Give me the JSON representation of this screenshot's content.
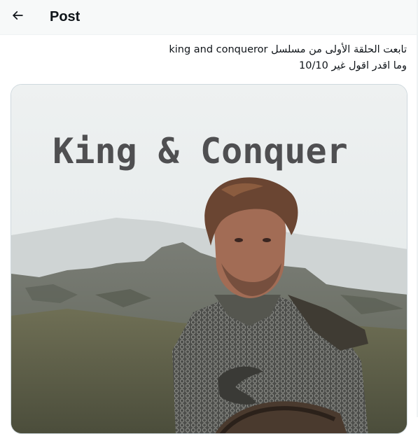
{
  "header": {
    "title": "Post",
    "back_icon": "arrow-left-icon"
  },
  "tweet": {
    "lines": [
      "تابعت الحلقة الأولى من مسلسل king and conqueror",
      "وما اقدر اقول غير 10/10"
    ]
  },
  "media": {
    "image_title": "King & Conquer"
  },
  "colors": {
    "text": "#0f1419",
    "border": "#cfd9de",
    "sky": "#e7ebec",
    "title_text": "#4f4f51"
  }
}
